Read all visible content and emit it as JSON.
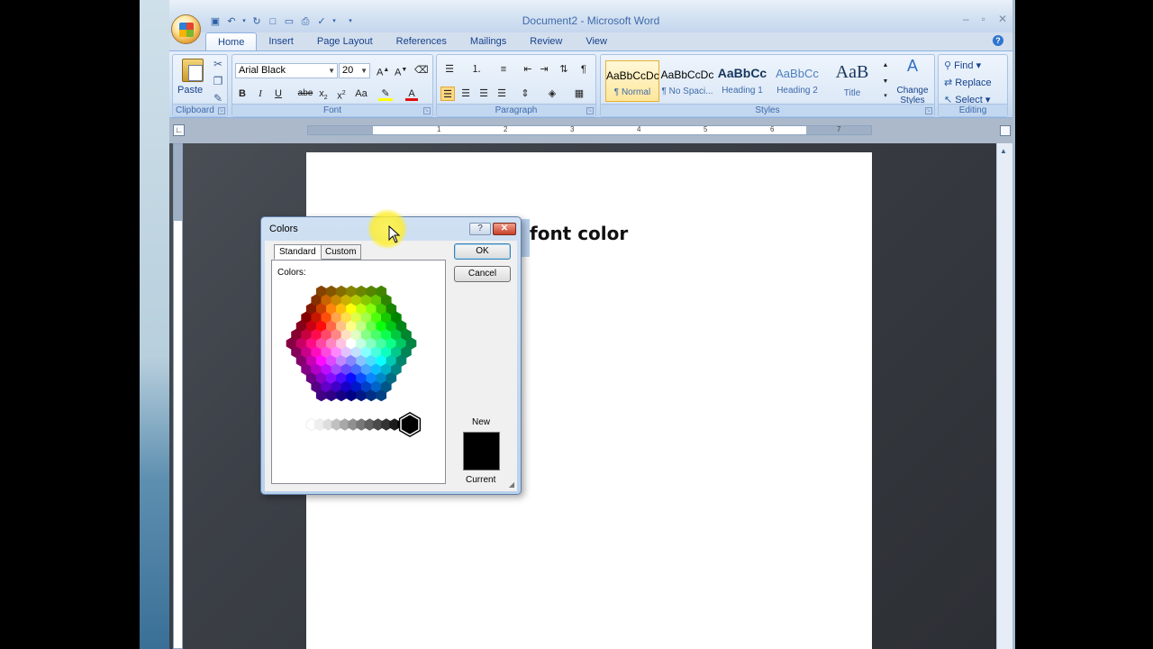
{
  "window": {
    "title": "Document2 - Microsoft Word"
  },
  "quick_access": [
    "save-icon",
    "undo-icon",
    "redo-icon",
    "new-icon",
    "open-icon",
    "print-preview-icon",
    "spelling-icon"
  ],
  "tabs": [
    {
      "label": "Home",
      "active": true
    },
    {
      "label": "Insert"
    },
    {
      "label": "Page Layout"
    },
    {
      "label": "References"
    },
    {
      "label": "Mailings"
    },
    {
      "label": "Review"
    },
    {
      "label": "View"
    }
  ],
  "ribbon": {
    "clipboard": {
      "label": "Clipboard",
      "paste": "Paste"
    },
    "font": {
      "label": "Font",
      "name": "Arial Black",
      "size": "20"
    },
    "paragraph": {
      "label": "Paragraph"
    },
    "styles": {
      "label": "Styles",
      "items": [
        {
          "sample": "AaBbCcDc",
          "name": "¶ Normal"
        },
        {
          "sample": "AaBbCcDc",
          "name": "¶ No Spaci..."
        },
        {
          "sample": "AaBbCc",
          "name": "Heading 1"
        },
        {
          "sample": "AaBbCc",
          "name": "Heading 2"
        },
        {
          "sample": "AaB",
          "name": "Title"
        }
      ],
      "change": "Change Styles"
    },
    "editing": {
      "label": "Editing",
      "find": "Find",
      "replace": "Replace",
      "select": "Select"
    }
  },
  "ruler": {
    "ticks": [
      "1",
      "2",
      "3",
      "4",
      "5",
      "6",
      "7"
    ]
  },
  "document": {
    "text": "font color"
  },
  "dialog": {
    "title": "Colors",
    "tabs": [
      "Standard",
      "Custom"
    ],
    "colors_label": "Colors:",
    "ok": "OK",
    "cancel": "Cancel",
    "new_label": "New",
    "current_label": "Current",
    "new_color": "#000000"
  }
}
